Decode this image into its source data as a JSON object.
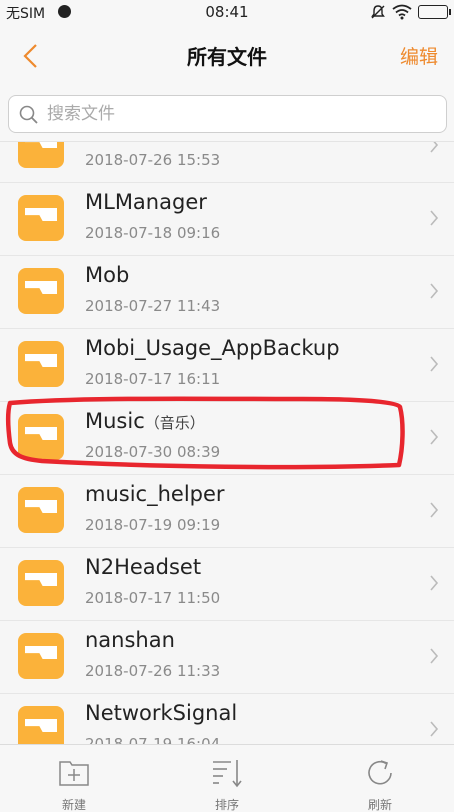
{
  "status_bar": {
    "sim": "无SIM",
    "time": "08:41",
    "icons": [
      "carrier-icon",
      "mute-icon",
      "wifi-icon",
      "battery-icon"
    ]
  },
  "header": {
    "title": "所有文件",
    "edit_label": "编辑",
    "accent_color": "#ee8a2e"
  },
  "search": {
    "placeholder": "搜索文件"
  },
  "files": [
    {
      "name": "",
      "date": "2018-07-26 15:53"
    },
    {
      "name": "MLManager",
      "date": "2018-07-18 09:16"
    },
    {
      "name": "Mob",
      "date": "2018-07-27 11:43"
    },
    {
      "name": "Mobi_Usage_AppBackup",
      "date": "2018-07-17 16:11"
    },
    {
      "name": "Music",
      "suffix": "（音乐）",
      "date": "2018-07-30 08:39",
      "highlighted": true
    },
    {
      "name": "music_helper",
      "date": "2018-07-19 09:19"
    },
    {
      "name": "N2Headset",
      "date": "2018-07-17 11:50"
    },
    {
      "name": "nanshan",
      "date": "2018-07-26 11:33"
    },
    {
      "name": "NetworkSignal",
      "date": "2018-07-19 16:04"
    }
  ],
  "toolbar": {
    "new_label": "新建",
    "sort_label": "排序",
    "refresh_label": "刷新"
  },
  "colors": {
    "folder": "#fbb23a",
    "highlight": "#e8262e"
  }
}
